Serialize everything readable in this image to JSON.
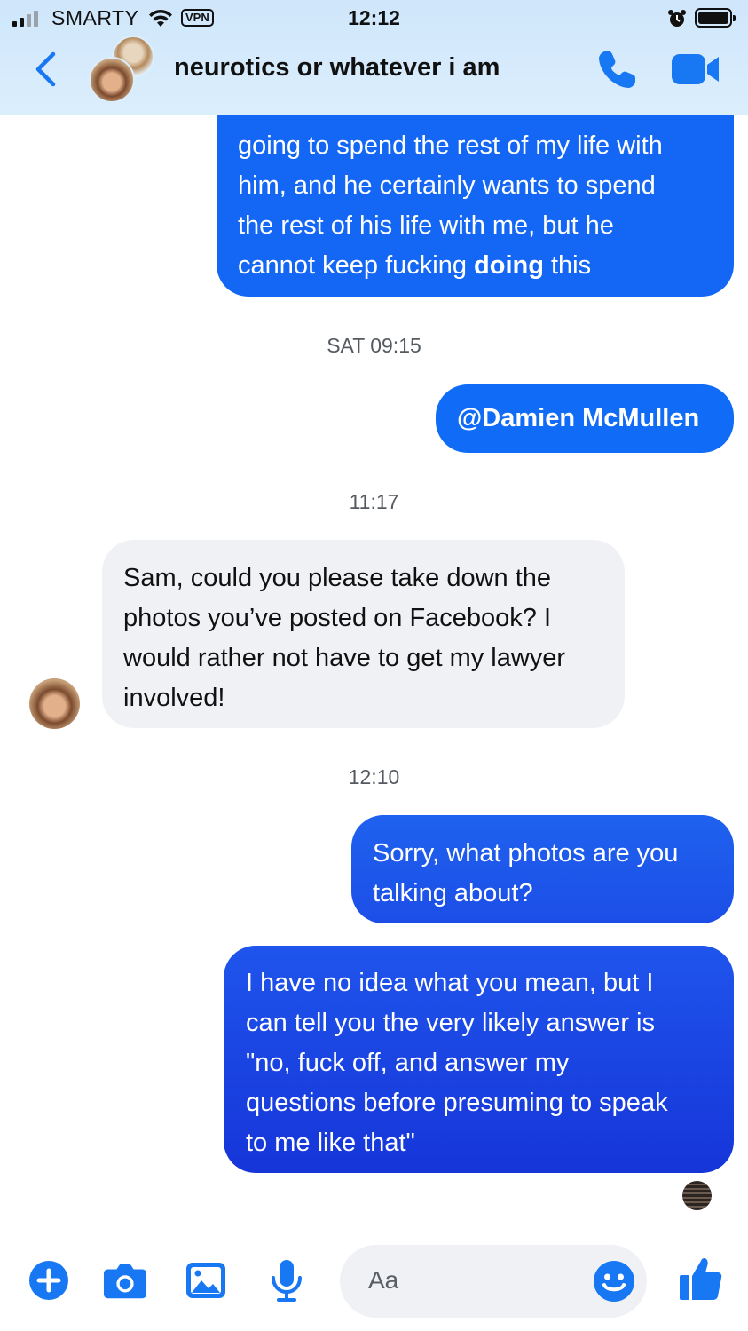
{
  "status_bar": {
    "carrier": "SMARTY",
    "vpn": "VPN",
    "time": "12:12"
  },
  "header": {
    "chat_title": "neurotics or whatever i am",
    "icons": [
      "back-chevron-icon",
      "phone-icon",
      "video-camera-icon"
    ]
  },
  "messages": [
    {
      "direction": "outgoing",
      "lines": [
        "going to spend the rest of my life with",
        "him, and he certainly wants to spend",
        "the rest of his life with me, but he"
      ],
      "last_line_before": "cannot keep fucking ",
      "last_line_bold": "doing",
      "last_line_after": " this"
    },
    {
      "type": "timestamp",
      "text": "SAT 09:15"
    },
    {
      "direction": "outgoing",
      "text": "@Damien McMullen"
    },
    {
      "type": "timestamp",
      "text": "11:17"
    },
    {
      "direction": "incoming",
      "lines": [
        "Sam, could you please take down the",
        "photos you’ve posted on Facebook? I",
        "would rather not have to get my lawyer",
        "involved!"
      ]
    },
    {
      "type": "timestamp",
      "text": "12:10"
    },
    {
      "direction": "outgoing",
      "lines": [
        "Sorry, what photos are you",
        "talking about?"
      ]
    },
    {
      "direction": "outgoing",
      "lines": [
        "I have no idea what you mean, but I",
        "can tell you the very likely answer is",
        "\"no, fuck off, and answer my",
        "questions before presuming to speak",
        "to me like that\""
      ]
    }
  ],
  "composer": {
    "placeholder": "Aa",
    "icons": [
      "plus-icon",
      "camera-icon",
      "gallery-icon",
      "microphone-icon",
      "emoji-icon",
      "thumbs-up-icon"
    ]
  },
  "colors": {
    "accent": "#1877f2",
    "bubble_outgoing": "#1467f4",
    "bubble_outgoing_dark": "#1635d9",
    "bubble_incoming": "#f0f1f5",
    "header_bg": "#d6ebfc"
  }
}
